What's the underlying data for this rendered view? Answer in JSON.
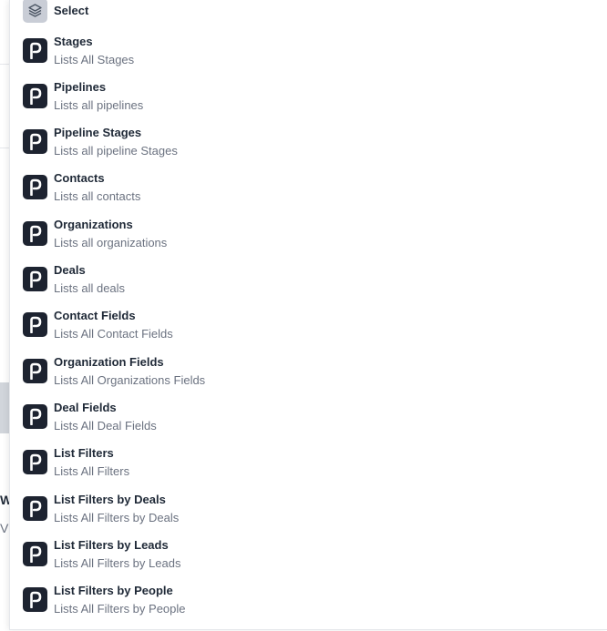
{
  "select": {
    "label": "Select",
    "icon": "layers-icon"
  },
  "items": [
    {
      "title": "Stages",
      "subtitle": "Lists All Stages",
      "icon": "pipedrive-icon"
    },
    {
      "title": "Pipelines",
      "subtitle": "Lists all pipelines",
      "icon": "pipedrive-icon"
    },
    {
      "title": "Pipeline Stages",
      "subtitle": "Lists all pipeline Stages",
      "icon": "pipedrive-icon"
    },
    {
      "title": "Contacts",
      "subtitle": "Lists all contacts",
      "icon": "pipedrive-icon"
    },
    {
      "title": "Organizations",
      "subtitle": "Lists all organizations",
      "icon": "pipedrive-icon"
    },
    {
      "title": "Deals",
      "subtitle": "Lists all deals",
      "icon": "pipedrive-icon"
    },
    {
      "title": "Contact Fields",
      "subtitle": "Lists All Contact Fields",
      "icon": "pipedrive-icon"
    },
    {
      "title": "Organization Fields",
      "subtitle": "Lists All Organizations Fields",
      "icon": "pipedrive-icon"
    },
    {
      "title": "Deal Fields",
      "subtitle": "Lists All Deal Fields",
      "icon": "pipedrive-icon"
    },
    {
      "title": "List Filters",
      "subtitle": "Lists All Filters",
      "icon": "pipedrive-icon"
    },
    {
      "title": "List Filters by Deals",
      "subtitle": "Lists All Filters by Deals",
      "icon": "pipedrive-icon"
    },
    {
      "title": "List Filters by Leads",
      "subtitle": "Lists All Filters by Leads",
      "icon": "pipedrive-icon"
    },
    {
      "title": "List Filters by People",
      "subtitle": "Lists All Filters by People",
      "icon": "pipedrive-icon"
    }
  ],
  "background": {
    "fragment_1": "W",
    "fragment_2": "V"
  }
}
